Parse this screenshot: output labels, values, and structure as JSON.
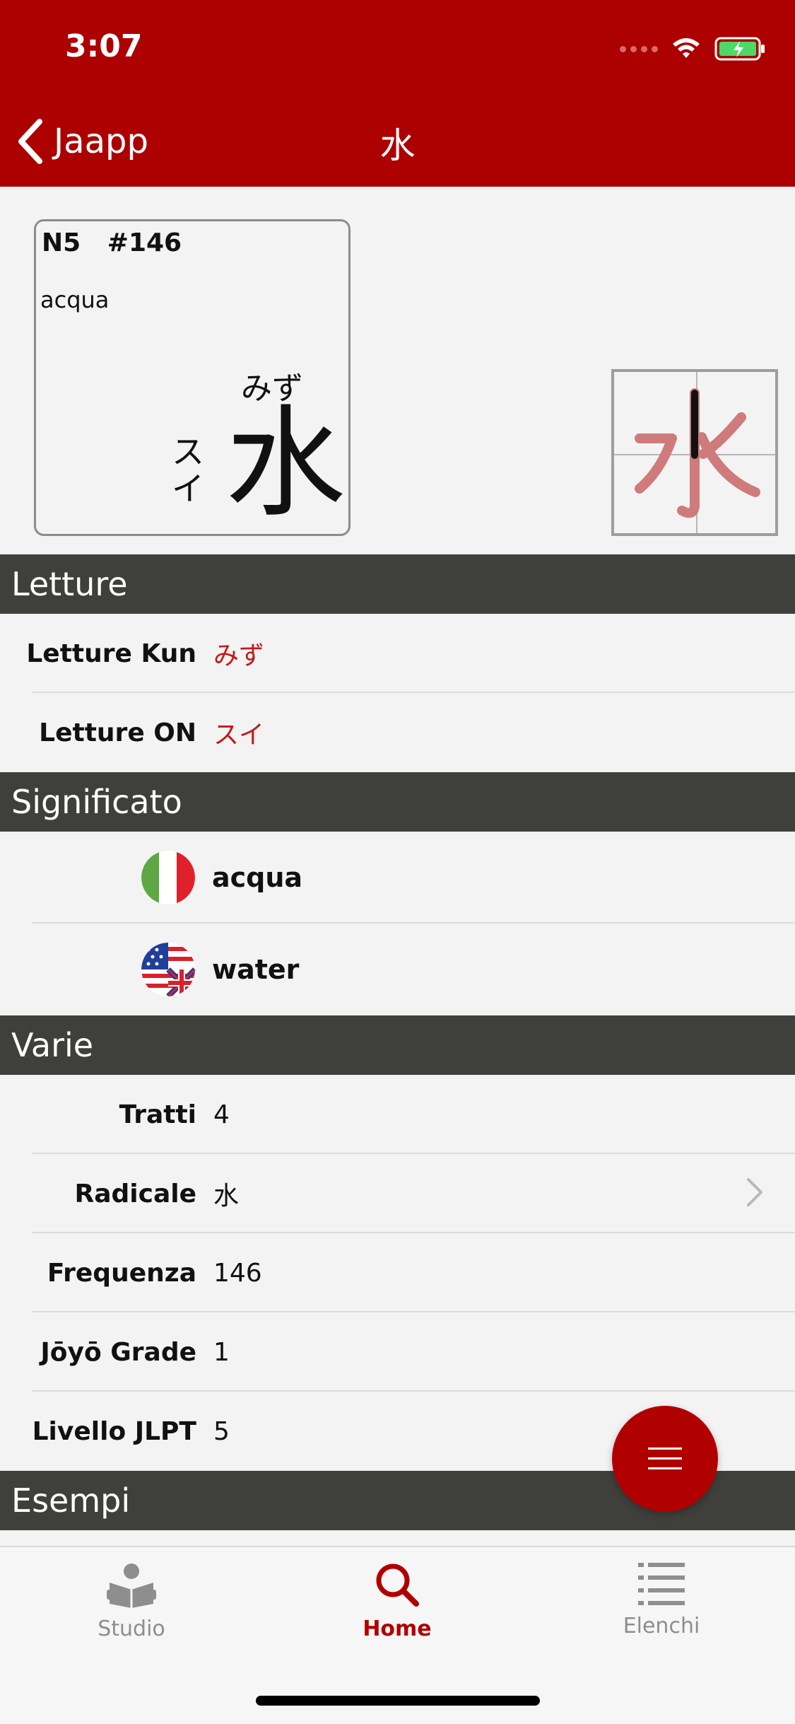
{
  "status_bar": {
    "time": "3:07"
  },
  "nav": {
    "back_label": "Jaapp",
    "title": "水"
  },
  "kanji_card": {
    "level": "N5",
    "number": "#146",
    "meaning": "acqua",
    "kun_reading": "みず",
    "on_reading": "スイ",
    "kanji": "水"
  },
  "stroke_diagram": {
    "kanji": "水"
  },
  "sections": {
    "letture": {
      "title": "Letture",
      "rows": [
        {
          "label": "Letture Kun",
          "value": "みず"
        },
        {
          "label": "Letture ON",
          "value": "スイ"
        }
      ]
    },
    "significato": {
      "title": "Significato",
      "rows": [
        {
          "flag": "italy-flag-icon",
          "value": "acqua"
        },
        {
          "flag": "uk-us-flag-icon",
          "value": "water"
        }
      ]
    },
    "varie": {
      "title": "Varie",
      "rows": [
        {
          "label": "Tratti",
          "value": "4"
        },
        {
          "label": "Radicale",
          "value": "水"
        },
        {
          "label": "Frequenza",
          "value": "146"
        },
        {
          "label": "Jōyō Grade",
          "value": "1"
        },
        {
          "label": "Livello JLPT",
          "value": "5"
        }
      ]
    },
    "esempi": {
      "title": "Esempi"
    }
  },
  "tabbar": {
    "tabs": [
      {
        "label": "Studio",
        "icon": "book-reader-icon"
      },
      {
        "label": "Home",
        "icon": "search-icon"
      },
      {
        "label": "Elenchi",
        "icon": "list-icon"
      }
    ],
    "active": "Home"
  },
  "colors": {
    "brand": "#ad0000",
    "section_header": "#3f3f3b",
    "reading_text": "#c11a1a",
    "inactive_tab": "#8e8e8e"
  }
}
